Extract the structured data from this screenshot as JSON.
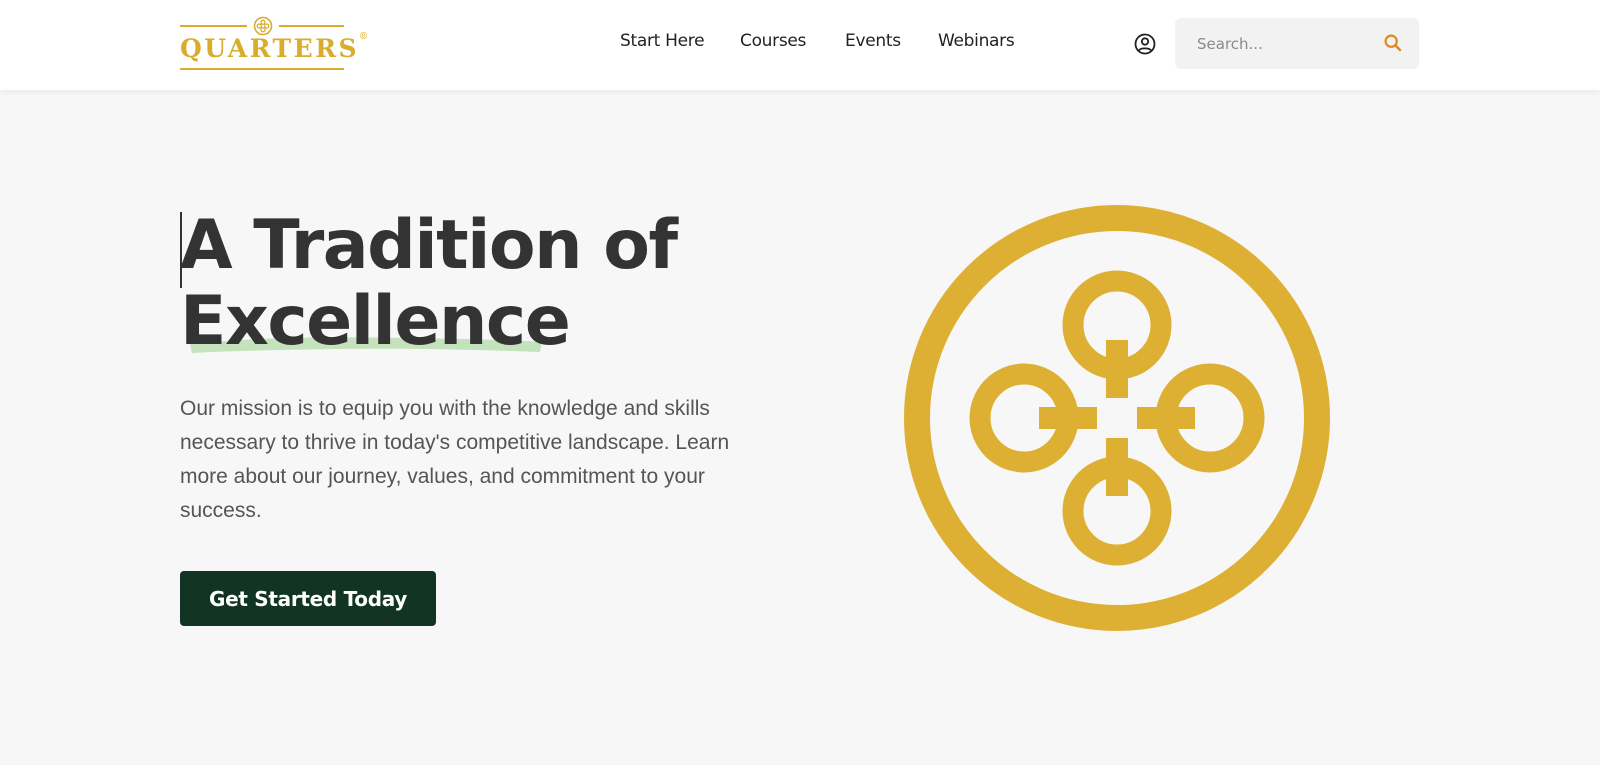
{
  "brand": {
    "name": "QUARTERS",
    "registered_mark": "®",
    "color": "#d9ac2c"
  },
  "nav": {
    "items": [
      {
        "label": "Start Here"
      },
      {
        "label": "Courses"
      },
      {
        "label": "Events"
      },
      {
        "label": "Webinars"
      }
    ]
  },
  "header": {
    "account_icon": "user-circle-icon",
    "search": {
      "placeholder": "Search...",
      "value": "",
      "icon": "search-icon",
      "icon_color": "#e08a1e"
    }
  },
  "hero": {
    "title_line1": "A Tradition of",
    "title_line2": "Excellence",
    "highlight_color": "#c4e2bb",
    "description": "Our mission is to equip you with the knowledge and skills necessary to thrive in today's competitive landscape. Learn more about our journey, values, and commitment to your success.",
    "cta_label": "Get Started Today",
    "cta_color": "#113522",
    "emblem_icon": "quarters-emblem-icon",
    "emblem_color": "#ddaf33"
  }
}
